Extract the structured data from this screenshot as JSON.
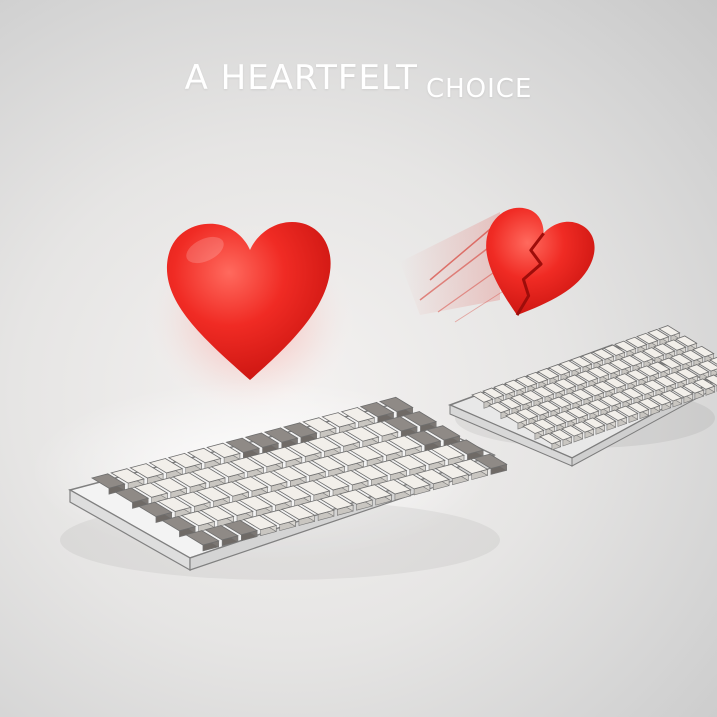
{
  "title": {
    "part1": "A HEARTFELT",
    "part2": "CHOICE"
  },
  "colors": {
    "heart_red": "#ee2222",
    "keycap_light": "#f2efea",
    "keycap_gray": "#8f8a86",
    "background": "#dcdcdc"
  },
  "icons": {
    "whole_heart": "heart-icon",
    "broken_heart": "broken-heart-icon"
  }
}
